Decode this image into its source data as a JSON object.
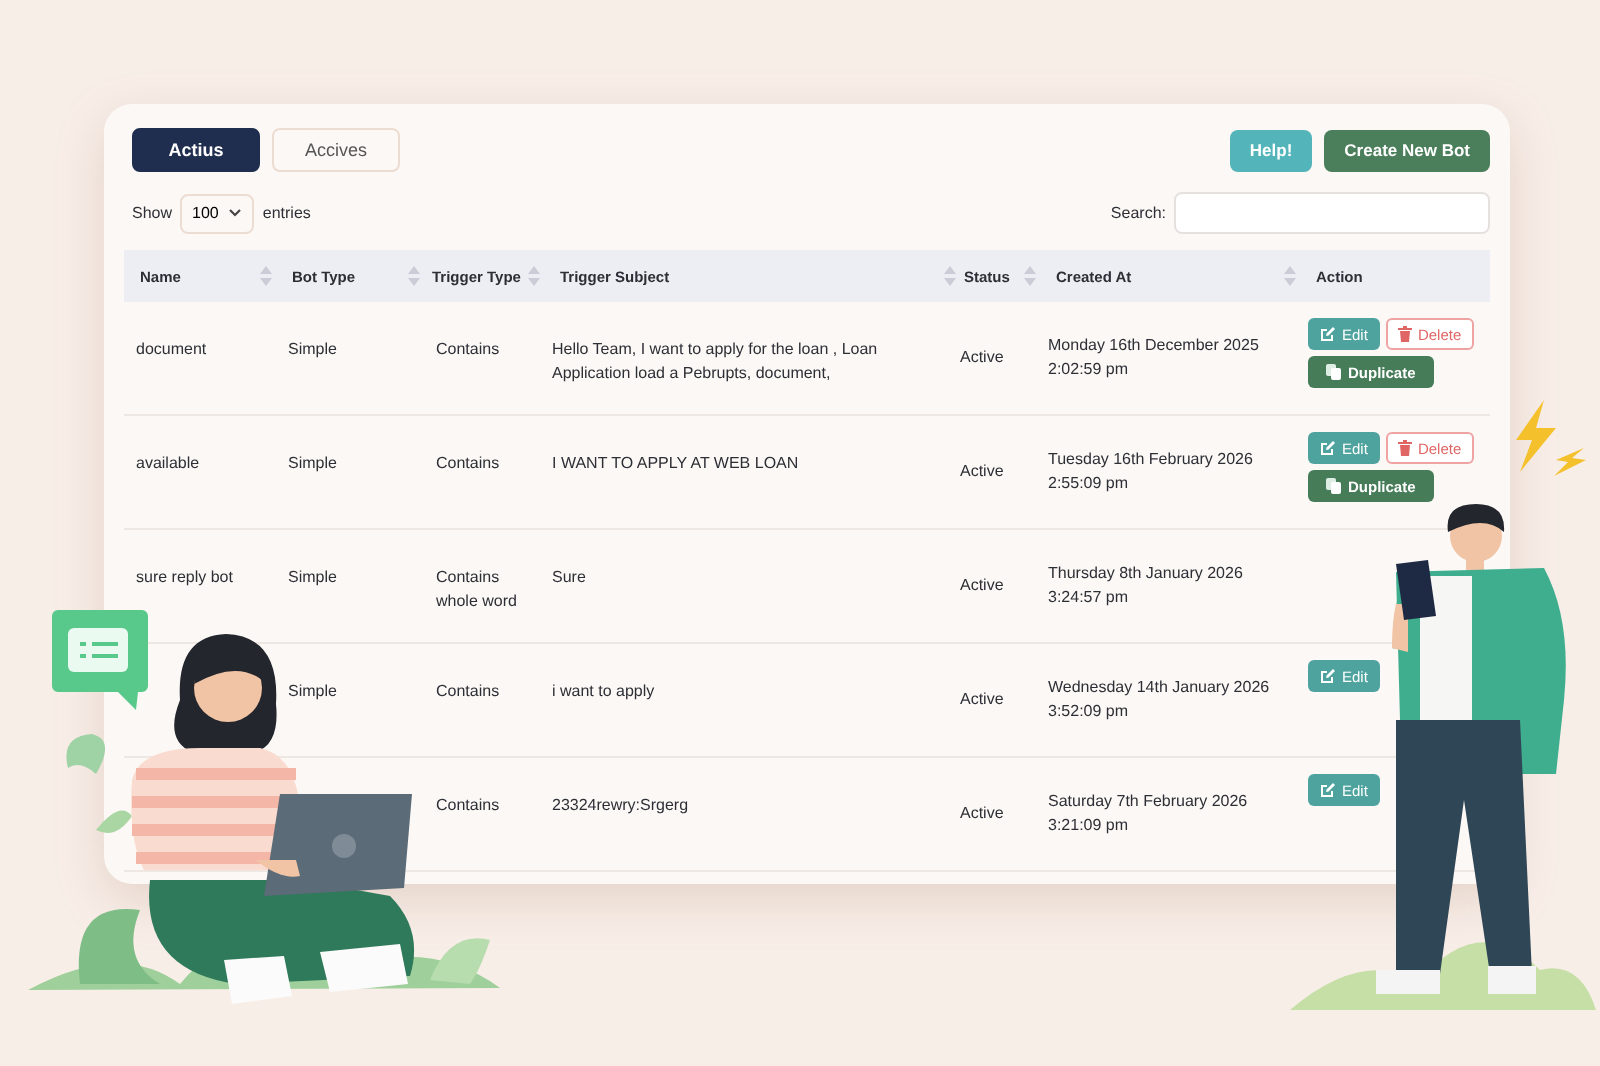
{
  "tabs": [
    {
      "label": "Actius",
      "selected": true
    },
    {
      "label": "Accives",
      "selected": false
    }
  ],
  "buttons": [
    {
      "label": "Help!",
      "kind": "help"
    },
    {
      "label": "Create New Bot",
      "kind": "create"
    }
  ],
  "length": {
    "before": "Show",
    "value": "100",
    "after": "entries"
  },
  "search": {
    "label": "Search:"
  },
  "table": {
    "columns": [
      {
        "label": "Name",
        "sortable": true
      },
      {
        "label": "Bot Type",
        "sortable": true
      },
      {
        "label": "Trigger Type",
        "sortable": true
      },
      {
        "label": "Trigger Subject",
        "sortable": true
      },
      {
        "label": "Status",
        "sortable": true
      },
      {
        "label": "Created At",
        "sortable": true
      },
      {
        "label": "Action",
        "sortable": false
      }
    ],
    "rows": [
      {
        "name": "document",
        "bot_type": "Simple",
        "trigger_type": "Contains",
        "trigger_subject": "Hello Team, I want to apply for the loan , Loan Application load a Pebrupts, document,",
        "status": "Active",
        "created_date": "Monday 16th December 2025",
        "created_time": "2:02:59 pm",
        "actions": [
          {
            "kind": "edit",
            "label": "Edit"
          },
          {
            "kind": "delete",
            "label": "Delete"
          },
          {
            "kind": "duplicate",
            "label": "Duplicate"
          }
        ]
      },
      {
        "name": "available",
        "bot_type": "Simple",
        "trigger_type": "Contains",
        "trigger_subject": "I WANT TO APPLY AT WEB LOAN",
        "status": "Active",
        "created_date": "Tuesday 16th February 2026",
        "created_time": "2:55:09 pm",
        "actions": [
          {
            "kind": "edit",
            "label": "Edit"
          },
          {
            "kind": "delete",
            "label": "Delete"
          },
          {
            "kind": "duplicate",
            "label": "Duplicate"
          }
        ]
      },
      {
        "name": "sure reply bot",
        "bot_type": "Simple",
        "trigger_type": "Contains whole word",
        "trigger_subject": "Sure",
        "status": "Active",
        "created_date": "Thursday 8th January 2026",
        "created_time": "3:24:57 pm"
      },
      {
        "bot_type": "Simple",
        "trigger_type": "Contains",
        "trigger_subject": "i want to apply",
        "status": "Active",
        "created_date": "Wednesday 14th January 2026",
        "created_time": "3:52:09 pm",
        "actions": [
          {
            "kind": "edit",
            "label": "Edit"
          }
        ]
      },
      {
        "trigger_type": "Contains",
        "trigger_subject": "23324rewry:Srgerg",
        "status": "Active",
        "created_date": "Saturday 7th February 2026",
        "created_time": "3:21:09 pm",
        "actions": [
          {
            "kind": "edit",
            "label": "Edit"
          }
        ]
      }
    ]
  }
}
